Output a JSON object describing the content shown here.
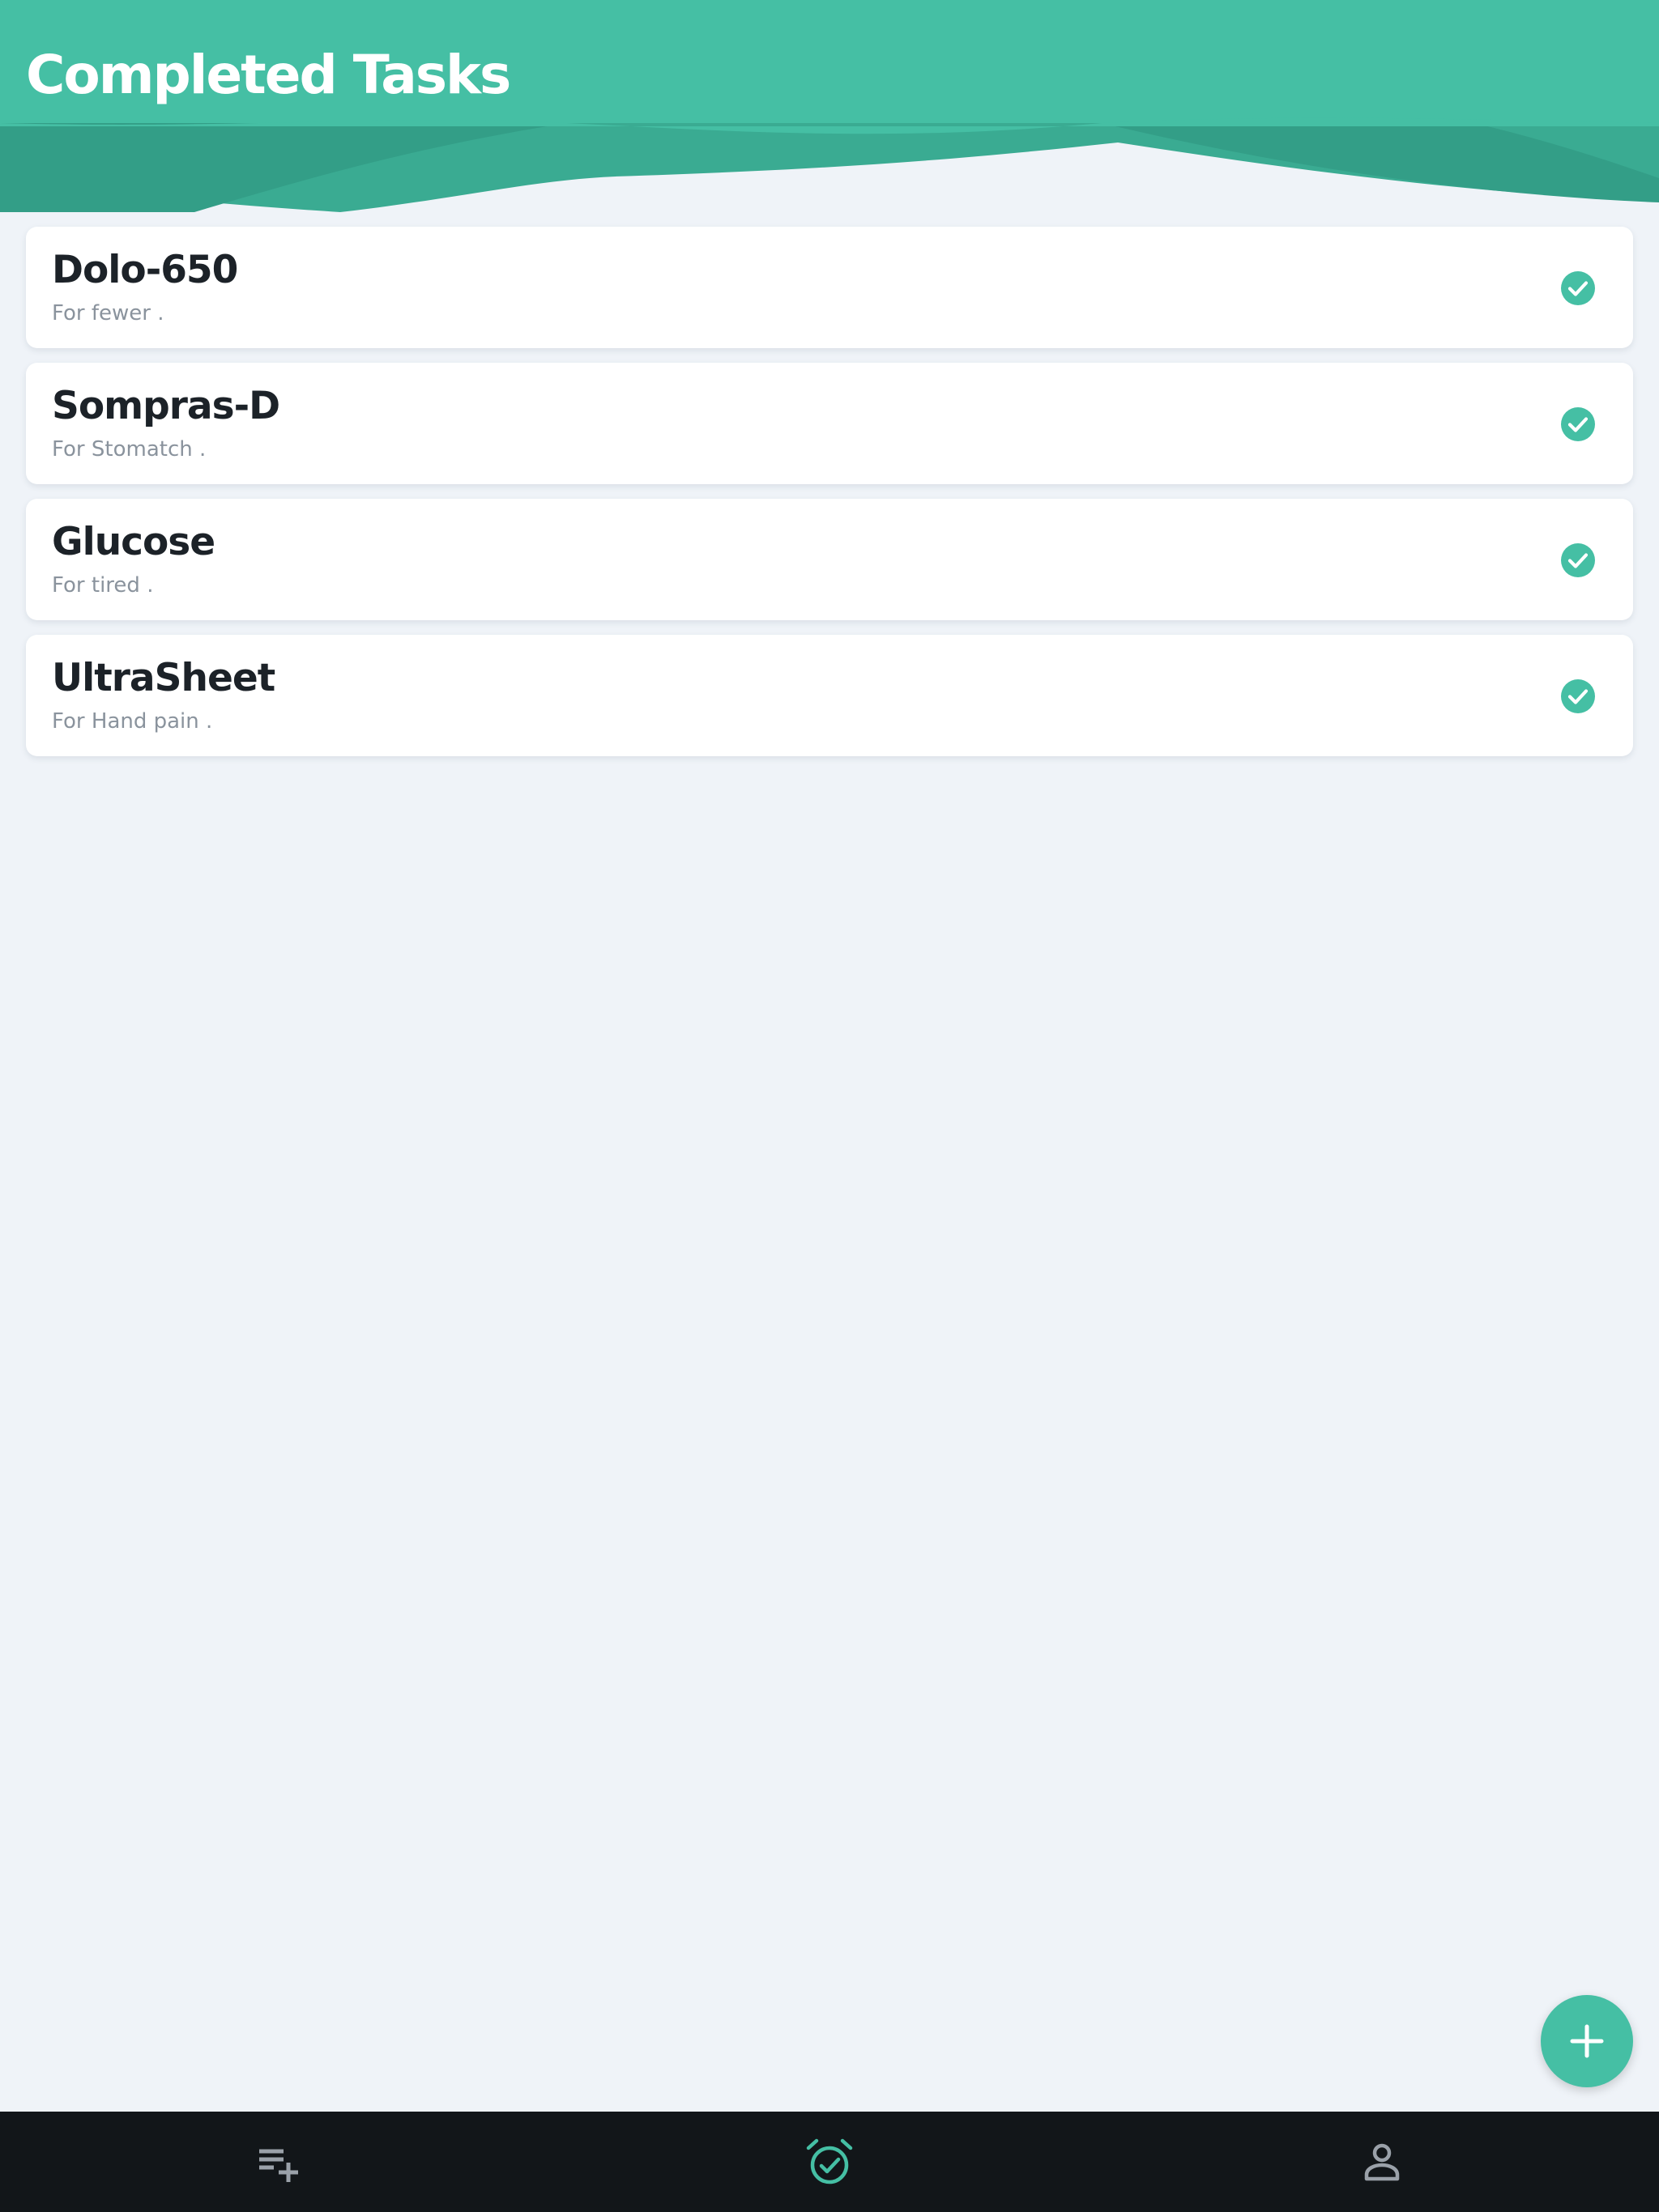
{
  "header": {
    "title": "Completed Tasks"
  },
  "tasks": [
    {
      "title": "Dolo-650",
      "description": "For fewer  .",
      "status_icon": "check-circle-icon"
    },
    {
      "title": "Sompras-D",
      "description": "For Stomatch  .",
      "status_icon": "check-circle-icon"
    },
    {
      "title": "Glucose",
      "description": "For tired  .",
      "status_icon": "check-circle-icon"
    },
    {
      "title": "UltraSheet",
      "description": "For Hand pain  .",
      "status_icon": "check-circle-icon"
    }
  ],
  "fab": {
    "icon": "plus-icon"
  },
  "bottom_nav": {
    "items": [
      {
        "icon": "playlist-add-icon",
        "active": false
      },
      {
        "icon": "alarm-check-icon",
        "active": true
      },
      {
        "icon": "person-icon",
        "active": false
      }
    ]
  },
  "colors": {
    "accent": "#45bfa4",
    "accent_dark": "#36a08a",
    "background": "#eff3f8",
    "nav_background": "#121619",
    "nav_inactive": "#9aa1a9",
    "title_text": "#1c2228",
    "subtitle_text": "#8a939d"
  }
}
